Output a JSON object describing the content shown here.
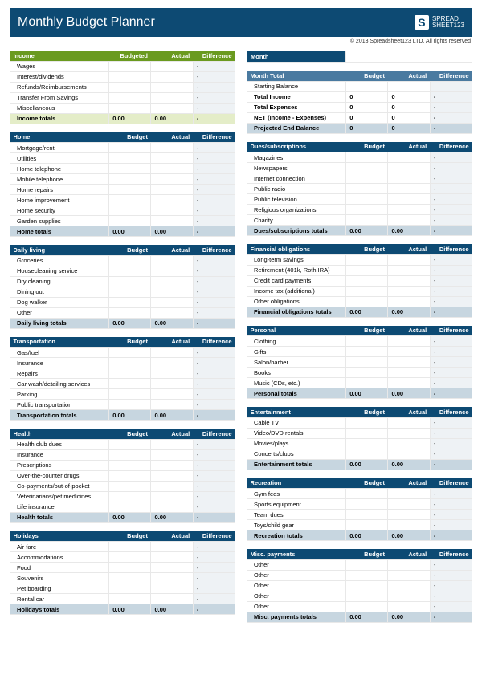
{
  "header": {
    "title": "Monthly Budget Planner",
    "logo_brand": "SPREAD",
    "logo_sheet": "SHEET123"
  },
  "copyright": "© 2013 Spreadsheet123 LTD. All rights reserved",
  "headers": {
    "budgeted": "Budgeted",
    "budget": "Budget",
    "actual": "Actual",
    "difference": "Difference"
  },
  "month": {
    "label": "Month",
    "value": ""
  },
  "month_total": {
    "title": "Month Total",
    "rows": [
      {
        "label": "Starting Balance",
        "budget": "",
        "actual": "",
        "diff": ""
      },
      {
        "label": "Total Income",
        "budget": "0",
        "actual": "0",
        "diff": "-"
      },
      {
        "label": "Total Expenses",
        "budget": "0",
        "actual": "0",
        "diff": "-"
      },
      {
        "label": "NET (Income - Expenses)",
        "budget": "0",
        "actual": "0",
        "diff": "-"
      }
    ],
    "projected": {
      "label": "Projected End Balance",
      "budget": "0",
      "actual": "0",
      "diff": "-"
    }
  },
  "income": {
    "title": "Income",
    "items": [
      "Wages",
      "Interest/dividends",
      "Refunds/Reimbursements",
      "Transfer From Savings",
      "Miscellaneous"
    ],
    "totals": {
      "label": "Income totals",
      "budget": "0.00",
      "actual": "0.00",
      "diff": "-"
    }
  },
  "left_sections": [
    {
      "title": "Home",
      "items": [
        "Mortgage/rent",
        "Utilities",
        "Home telephone",
        "Mobile telephone",
        "Home repairs",
        "Home improvement",
        "Home security",
        "Garden supplies"
      ],
      "totals": "Home totals"
    },
    {
      "title": "Daily living",
      "items": [
        "Groceries",
        "Housecleaning service",
        "Dry cleaning",
        "Dining out",
        "Dog walker",
        "Other"
      ],
      "totals": "Daily living totals"
    },
    {
      "title": "Transportation",
      "items": [
        "Gas/fuel",
        "Insurance",
        "Repairs",
        "Car wash/detailing services",
        "Parking",
        "Public transportation"
      ],
      "totals": "Transportation totals"
    },
    {
      "title": "Health",
      "items": [
        "Health club dues",
        "Insurance",
        "Prescriptions",
        "Over-the-counter drugs",
        "Co-payments/out-of-pocket",
        "Veterinarians/pet medicines",
        "Life insurance"
      ],
      "totals": "Health totals"
    },
    {
      "title": "Holidays",
      "items": [
        "Air fare",
        "Accommodations",
        "Food",
        "Souvenirs",
        "Pet boarding",
        "Rental car"
      ],
      "totals": "Holidays totals"
    }
  ],
  "right_sections": [
    {
      "title": "Dues/subscriptions",
      "items": [
        "Magazines",
        "Newspapers",
        "Internet connection",
        "Public radio",
        "Public television",
        "Religious organizations",
        "Charity"
      ],
      "totals": "Dues/subscriptions totals"
    },
    {
      "title": "Financial obligations",
      "items": [
        "Long-term savings",
        "Retirement (401k, Roth IRA)",
        "Credit card payments",
        "Income tax (additional)",
        "Other obligations"
      ],
      "totals": "Financial obligations totals"
    },
    {
      "title": "Personal",
      "items": [
        "Clothing",
        "Gifts",
        "Salon/barber",
        "Books",
        "Music (CDs, etc.)"
      ],
      "totals": "Personal totals"
    },
    {
      "title": "Entertainment",
      "items": [
        "Cable TV",
        "Video/DVD rentals",
        "Movies/plays",
        "Concerts/clubs"
      ],
      "totals": "Entertainment totals"
    },
    {
      "title": "Recreation",
      "items": [
        "Gym fees",
        "Sports equipment",
        "Team dues",
        "Toys/child gear"
      ],
      "totals": "Recreation totals"
    },
    {
      "title": "Misc. payments",
      "items": [
        "Other",
        "Other",
        "Other",
        "Other",
        "Other"
      ],
      "totals": "Misc. payments totals"
    }
  ],
  "std_totals": {
    "budget": "0.00",
    "actual": "0.00",
    "diff": "-"
  },
  "dash": "-"
}
